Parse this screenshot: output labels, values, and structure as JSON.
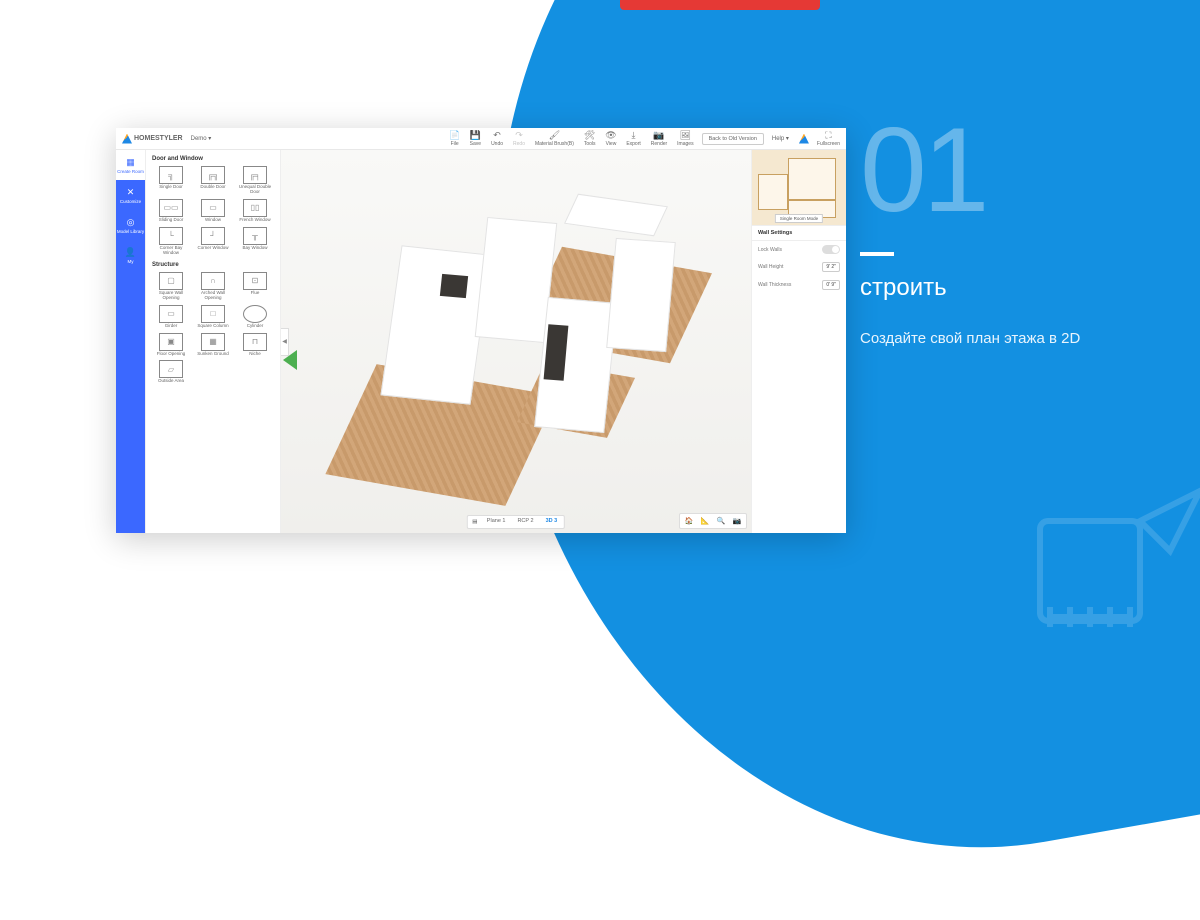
{
  "app": {
    "brand": "HOMESTYLER",
    "project_dropdown": "Demo ▾",
    "toolbar": [
      {
        "icon": "📄",
        "label": "File"
      },
      {
        "icon": "💾",
        "label": "Save"
      },
      {
        "icon": "↶",
        "label": "Undo"
      },
      {
        "icon": "↷",
        "label": "Redo"
      },
      {
        "icon": "🖌",
        "label": "Material Brush(B)"
      },
      {
        "icon": "🛠",
        "label": "Tools"
      },
      {
        "icon": "👁",
        "label": "View"
      },
      {
        "icon": "⤓",
        "label": "Export"
      },
      {
        "icon": "📷",
        "label": "Render"
      },
      {
        "icon": "🖼",
        "label": "Images"
      }
    ],
    "back_button": "Back to Old Version",
    "help": "Help ▾",
    "fullscreen": "Fullscreen"
  },
  "left_nav": [
    {
      "icon": "▦",
      "label": "Create Room",
      "active": false
    },
    {
      "icon": "✕",
      "label": "Customize",
      "active": true
    },
    {
      "icon": "◎",
      "label": "Model Library",
      "active": false
    },
    {
      "icon": "👤",
      "label": "My",
      "active": false
    }
  ],
  "palette": {
    "section1_title": "Door and Window",
    "section1": [
      {
        "label": "Single Door"
      },
      {
        "label": "Double Door"
      },
      {
        "label": "Unequal Double Door"
      },
      {
        "label": "Sliding Door"
      },
      {
        "label": "Window"
      },
      {
        "label": "French Window"
      },
      {
        "label": "Corner Bay Window"
      },
      {
        "label": "Corner Window"
      },
      {
        "label": "Bay Window"
      }
    ],
    "section2_title": "Structure",
    "section2": [
      {
        "label": "Square Wall Opening"
      },
      {
        "label": "Arched Wall Opening"
      },
      {
        "label": "Flue"
      },
      {
        "label": "Girder"
      },
      {
        "label": "Square Column"
      },
      {
        "label": "Cylinder"
      },
      {
        "label": "Floor Opening"
      },
      {
        "label": "Sunken Ground"
      },
      {
        "label": "Niche"
      },
      {
        "label": "Outside Area"
      }
    ]
  },
  "views": {
    "plane": "Plane 1",
    "rcp": "RCP 2",
    "three_d": "3D 3"
  },
  "right": {
    "minimap_mode": "Single Room Mode",
    "wall_settings_title": "Wall Settings",
    "lock_walls": "Lock Walls",
    "wall_height_label": "Wall Height",
    "wall_height_value": "9' 2\"",
    "wall_thickness_label": "Wall Thickness",
    "wall_thickness_value": "0' 9\""
  },
  "promo": {
    "number": "01",
    "title": "строить",
    "desc": "Создайте свой план этажа в 2D"
  }
}
